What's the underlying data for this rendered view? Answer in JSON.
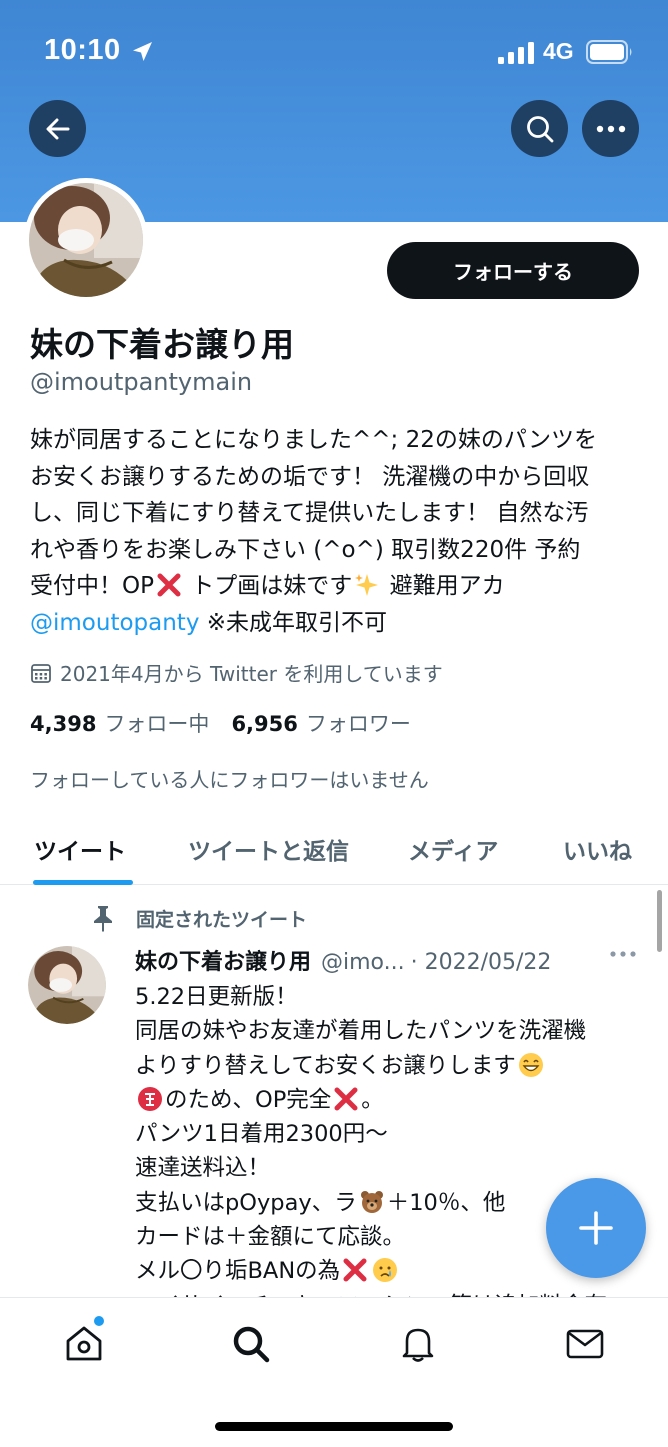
{
  "status_bar": {
    "time": "10:10",
    "network": "4G"
  },
  "header": {
    "back_icon": "arrow-left-icon",
    "search_icon": "search-icon",
    "more_icon": "more-horizontal-icon"
  },
  "colors": {
    "banner": "#4a94e0",
    "accent": "#1d9bf0",
    "follow_button": "#0f1419",
    "fab": "#4a99e9"
  },
  "profile": {
    "follow_label": "フォローする",
    "name": "妹の下着お譲り用",
    "handle": "@imoutpantymain",
    "bio_lines": [
      "妹が同居することになりました^^; 22の妹のパンツを",
      "お安くお譲りするための垢です！ 洗濯機の中から回収",
      "し、同じ下着にすり替えて提供いたします！ 自然な汚",
      "れや香りをお楽しみ下さい (^o^) 取引数220件 予約",
      "受付中！OP"
    ],
    "bio_line5_rest": " トプ画は妹です",
    "bio_line5_end": " 避難用アカ",
    "bio_link": "@imoutopanty",
    "bio_after_link": " ※未成年取引不可",
    "joined": "2021年4月から Twitter を利用しています",
    "following_count": "4,398",
    "following_label": "フォロー中",
    "followers_count": "6,956",
    "followers_label": "フォロワー",
    "followers_note": "フォローしている人にフォロワーはいません"
  },
  "tabs": [
    {
      "label": "ツイート",
      "active": true
    },
    {
      "label": "ツイートと返信",
      "active": false
    },
    {
      "label": "メディア",
      "active": false
    },
    {
      "label": "いいね",
      "active": false
    }
  ],
  "tweet": {
    "pinned_label": "固定されたツイート",
    "author_name": "妹の下着お譲り用",
    "author_handle": "@imo...",
    "date": "· 2022/05/22",
    "line1": "5.22日更新版！",
    "line2": "同居の妹やお友達が着用したパンツを洗濯機",
    "line3": "よりすり替えしてお安くお譲りします",
    "line4": "のため、OP完全",
    "line4_end": "。",
    "line5": "パンツ1日着用2300円〜",
    "line6": "速達送料込！",
    "line7a": "支払いはpOypay、ラ",
    "line7b": "＋10％、他",
    "line8": "カードは＋金額にて応談。",
    "line9": "メル〇り垢BANの為",
    "line10": "ユイサイ・チェキ・フィシンユ等は追加料金有"
  },
  "fab": {
    "icon": "plus-icon"
  },
  "bottom_nav": [
    {
      "icon": "home-icon"
    },
    {
      "icon": "search-icon"
    },
    {
      "icon": "bell-icon"
    },
    {
      "icon": "mail-icon"
    }
  ]
}
